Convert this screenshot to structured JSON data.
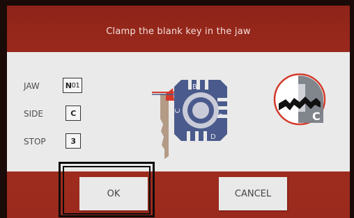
{
  "header": {
    "instruction": "Clamp the blank key in the jaw"
  },
  "settings": [
    {
      "label": "JAW",
      "value_bold": "N",
      "value_rest": "01"
    },
    {
      "label": "SIDE",
      "value_bold": "C",
      "value_rest": ""
    },
    {
      "label": "STOP",
      "value_bold": "3",
      "value_rest": ""
    }
  ],
  "diagram": {
    "jaw_face_labels": [
      "A",
      "B",
      "C",
      "D"
    ],
    "side_badge": "C",
    "icons": [
      "clamp-jaw-diagram",
      "key-side-indicator-icon"
    ]
  },
  "buttons": {
    "ok_label": "OK",
    "cancel_label": "CANCEL"
  },
  "colors": {
    "screen_red": "#a4301f",
    "panel_gray": "#eaeaea",
    "jaw_blue": "#4a5a8c",
    "accent_red": "#d33a2a",
    "badge_gray": "#7a7f87"
  }
}
